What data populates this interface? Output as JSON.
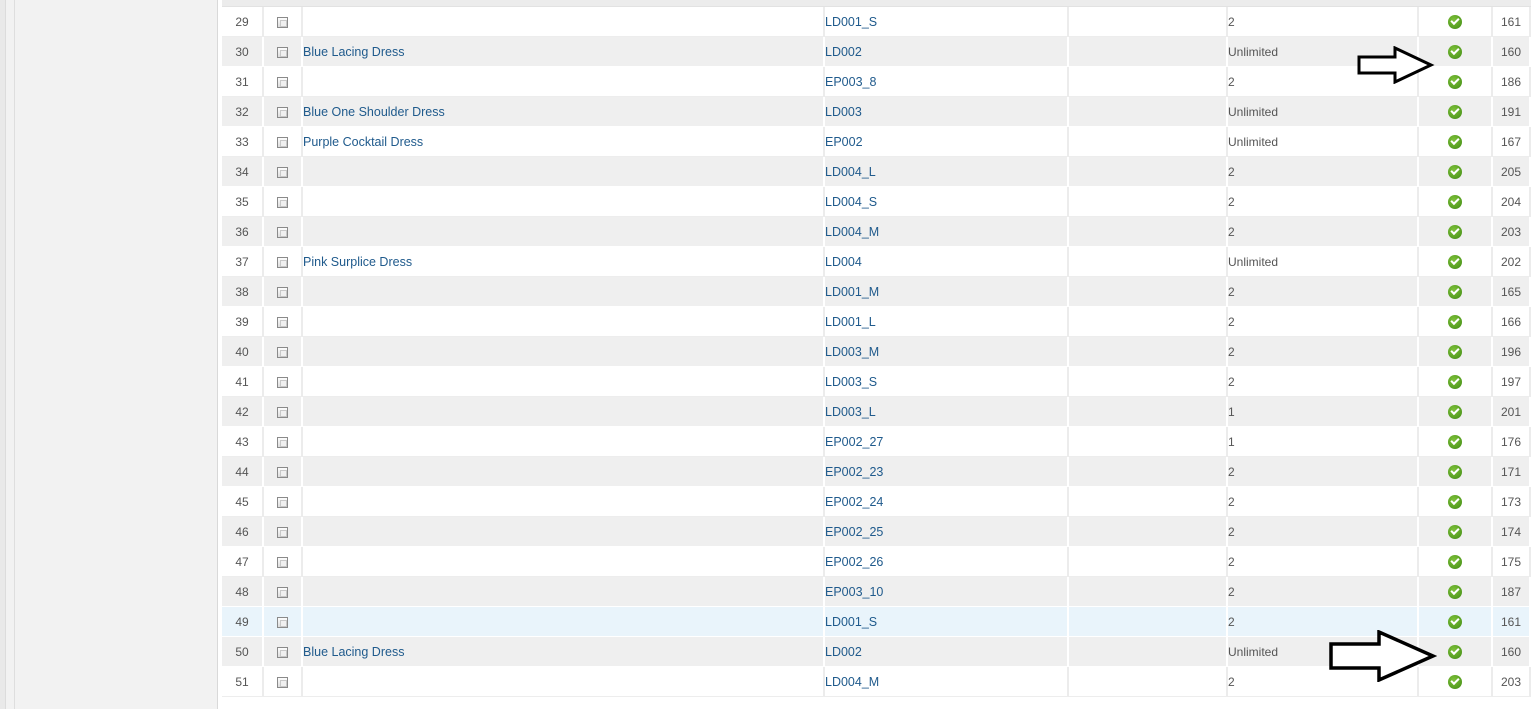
{
  "rows": [
    {
      "num": "29",
      "name": "",
      "sku": "LD001_S",
      "qty": "2",
      "id": "161"
    },
    {
      "num": "30",
      "name": "Blue Lacing Dress",
      "sku": "LD002",
      "qty": "Unlimited",
      "id": "160"
    },
    {
      "num": "31",
      "name": "",
      "sku": "EP003_8",
      "qty": "2",
      "id": "186"
    },
    {
      "num": "32",
      "name": "Blue One Shoulder Dress",
      "sku": "LD003",
      "qty": "Unlimited",
      "id": "191"
    },
    {
      "num": "33",
      "name": "Purple Cocktail Dress",
      "sku": "EP002",
      "qty": "Unlimited",
      "id": "167"
    },
    {
      "num": "34",
      "name": "",
      "sku": "LD004_L",
      "qty": "2",
      "id": "205"
    },
    {
      "num": "35",
      "name": "",
      "sku": "LD004_S",
      "qty": "2",
      "id": "204"
    },
    {
      "num": "36",
      "name": "",
      "sku": "LD004_M",
      "qty": "2",
      "id": "203"
    },
    {
      "num": "37",
      "name": "Pink Surplice Dress",
      "sku": "LD004",
      "qty": "Unlimited",
      "id": "202"
    },
    {
      "num": "38",
      "name": "",
      "sku": "LD001_M",
      "qty": "2",
      "id": "165"
    },
    {
      "num": "39",
      "name": "",
      "sku": "LD001_L",
      "qty": "2",
      "id": "166"
    },
    {
      "num": "40",
      "name": "",
      "sku": "LD003_M",
      "qty": "2",
      "id": "196"
    },
    {
      "num": "41",
      "name": "",
      "sku": "LD003_S",
      "qty": "2",
      "id": "197"
    },
    {
      "num": "42",
      "name": "",
      "sku": "LD003_L",
      "qty": "1",
      "id": "201"
    },
    {
      "num": "43",
      "name": "",
      "sku": "EP002_27",
      "qty": "1",
      "id": "176"
    },
    {
      "num": "44",
      "name": "",
      "sku": "EP002_23",
      "qty": "2",
      "id": "171"
    },
    {
      "num": "45",
      "name": "",
      "sku": "EP002_24",
      "qty": "2",
      "id": "173"
    },
    {
      "num": "46",
      "name": "",
      "sku": "EP002_25",
      "qty": "2",
      "id": "174"
    },
    {
      "num": "47",
      "name": "",
      "sku": "EP002_26",
      "qty": "2",
      "id": "175"
    },
    {
      "num": "48",
      "name": "",
      "sku": "EP003_10",
      "qty": "2",
      "id": "187"
    },
    {
      "num": "49",
      "name": "",
      "sku": "LD001_S",
      "qty": "2",
      "id": "161"
    },
    {
      "num": "50",
      "name": "Blue Lacing Dress",
      "sku": "LD002",
      "qty": "Unlimited",
      "id": "160"
    },
    {
      "num": "51",
      "name": "",
      "sku": "LD004_M",
      "qty": "2",
      "id": "203"
    }
  ],
  "highlighted_row": "49",
  "status_icon": "check-circle-icon",
  "colors": {
    "link": "#1f5a8c",
    "row_alt": "#efefef",
    "row_highlight": "#e9f4fb",
    "status_ok": "#4e9a1c"
  }
}
